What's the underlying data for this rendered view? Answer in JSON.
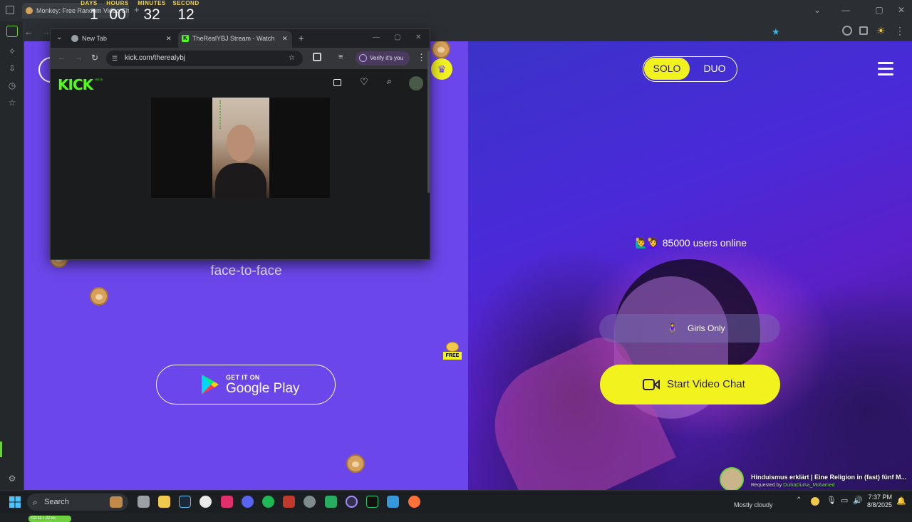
{
  "outer_browser": {
    "tab_title": "Monkey: Free Random Video Chat",
    "window_buttons": [
      "⌄",
      "—",
      "▢",
      "✕"
    ]
  },
  "countdown": {
    "days_label": "DAYS",
    "days": "1",
    "hours_label": "HOURS",
    "hours": "00",
    "minutes_label": "MINUTES",
    "minutes": "32",
    "seconds_label": "SECOND",
    "seconds": "12"
  },
  "popup": {
    "tab_new": "New Tab",
    "tab_kick": "TheRealYBJ Stream - Watch Live",
    "url": "kick.com/therealybj",
    "verify_chip": "Verify it's you",
    "logo": "KICK",
    "logo_badge": "BETA"
  },
  "left_panel": {
    "tagline": "face-to-face",
    "gplay_top": "GET IT ON",
    "gplay_main": "Google Play"
  },
  "right_panel": {
    "solo": "SOLO",
    "duo": "DUO",
    "users_online": "85000 users online",
    "users_emoji": "🙋‍♂️🙋‍♀️",
    "girls_only": "Girls Only",
    "start_chat": "Start Video Chat",
    "free_badge": "FREE"
  },
  "now_playing": {
    "title": "Hinduismus erklärt | Eine Religion in (fast) fünf M...",
    "requested_by_label": "Requested by",
    "requested_by": "DurkaDurka_Mohamed",
    "progress": "02:11 / 22:xx"
  },
  "taskbar": {
    "search_placeholder": "Search",
    "weather": "Mostly cloudy",
    "time": "7:37 PM",
    "date": "8/8/2025"
  },
  "colors": {
    "left_bg": "#6b46ea",
    "accent_yellow": "#f2f21f",
    "kick_green": "#53fc18"
  }
}
